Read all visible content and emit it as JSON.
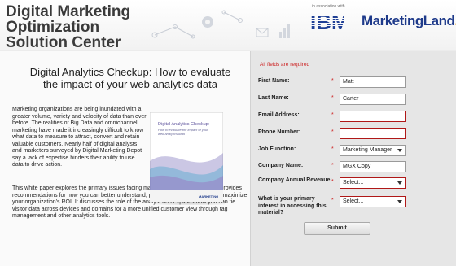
{
  "header": {
    "title_line1": "Digital Marketing Optimization",
    "title_line2": "Solution Center",
    "assoc_text": "in association with",
    "ibm_logo": "IBM",
    "ml_logo_a": "Marketing",
    "ml_logo_b": "Land",
    "ml_logo_dot": "."
  },
  "main": {
    "headline_line1": "Digital Analytics Checkup: How to evaluate",
    "headline_line2": "the impact of your web analytics data",
    "para1": "Marketing organizations are being inundated with a greater volume, variety and velocity of data than ever before. The realities of Big Data and omnichannel marketing have made it increasingly difficult to know what data to measure to attract, convert and retain valuable customers. Nearly half of digital analysts and marketers surveyed by Digital Marketing Depot say a lack of expertise hinders their ability to use data to drive action.",
    "para2": "This white paper explores the primary issues facing marketing analysts today, and provides recommendations for how you can better understand, present and act upon data to maximize your organization's ROI. It discusses the role of the analyst and explains how you can tie visitor data across devices and domains for a more unified customer view through tag management and other analytics tools.",
    "cover_title": "Digital Analytics Checkup:",
    "cover_subtitle": "How to evaluate the impact of your web analytics data",
    "cover_brand": "MARKETING"
  },
  "form": {
    "required_note": "All fields are required",
    "fields": [
      {
        "label": "First Name:",
        "value": "Matt"
      },
      {
        "label": "Last Name:",
        "value": "Carter"
      },
      {
        "label": "Email Address:",
        "value": ""
      },
      {
        "label": "Phone Number:",
        "value": ""
      },
      {
        "label": "Job Function:",
        "value": "Marketing Manager"
      },
      {
        "label": "Company Name:",
        "value": "MGX Copy"
      },
      {
        "label": "Company Annual Revenue:",
        "value": "Select..."
      },
      {
        "label": "What is your primary interest in accessing this material?",
        "value": "Select..."
      }
    ],
    "required_mark": "*",
    "submit_label": "Submit"
  },
  "colors": {
    "required_red": "#cc1f1f",
    "ibm_blue": "#1f3f95",
    "ml_blue": "#1e3a8a",
    "ml_accent": "#e8a11a"
  },
  "icons": [
    "gear-icon",
    "email-icon",
    "network-icon",
    "chart-icon"
  ]
}
